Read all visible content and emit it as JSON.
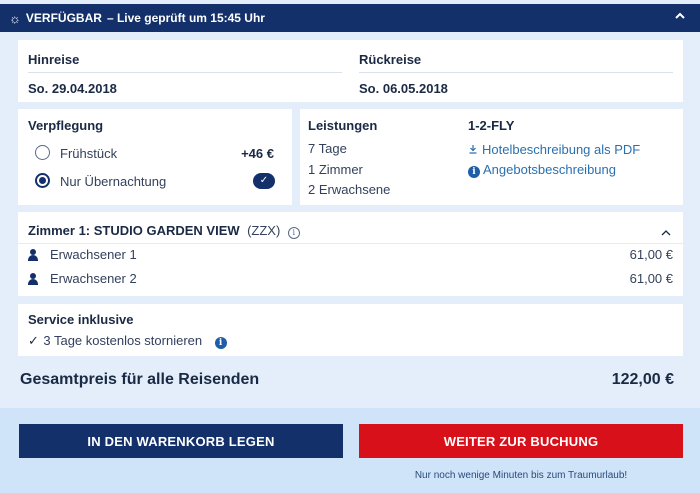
{
  "header": {
    "status": "VERFÜGBAR",
    "live": "– Live geprüft um 15:45 Uhr"
  },
  "travel": {
    "outbound_label": "Hinreise",
    "outbound_value": "So. 29.04.2018",
    "return_label": "Rückreise",
    "return_value": "So. 06.05.2018"
  },
  "board": {
    "title": "Verpflegung",
    "options": [
      {
        "label": "Frühstück",
        "price": "+46 €",
        "selected": false
      },
      {
        "label": "Nur Übernachtung",
        "selected": true
      }
    ]
  },
  "services": {
    "title": "Leistungen",
    "items": [
      "7 Tage",
      "1 Zimmer",
      "2 Erwachsene"
    ],
    "operator": "1-2-FLY",
    "pdf_link": "Hotelbeschreibung als PDF",
    "offer_link": "Angebotsbeschreibung"
  },
  "room": {
    "title": "Zimmer 1: STUDIO GARDEN VIEW",
    "code": "(ZZX)",
    "guests": [
      {
        "label": "Erwachsener 1",
        "price": "61,00 €"
      },
      {
        "label": "Erwachsener 2",
        "price": "61,00 €"
      }
    ]
  },
  "service_included": {
    "title": "Service inklusive",
    "item": "3 Tage kostenlos stornieren"
  },
  "total": {
    "label": "Gesamtpreis für alle Reisenden",
    "value": "122,00 €"
  },
  "actions": {
    "cart_label": "IN DEN WARENKORB LEGEN",
    "booking_label": "WEITER ZUR BUCHUNG",
    "hint": "Nur noch wenige Minuten bis zum Traumurlaub!"
  },
  "colors": {
    "navy": "#13306b",
    "red": "#d8101a",
    "link": "#2a6fb0",
    "background": "#e3eefa"
  }
}
